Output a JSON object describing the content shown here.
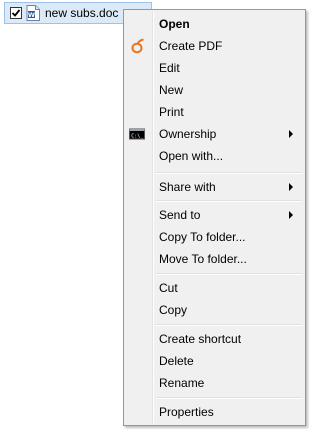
{
  "file": {
    "name": "new subs.doc",
    "checked": true
  },
  "menu": {
    "items": [
      {
        "label": "Open"
      },
      {
        "label": "Create PDF",
        "icon": "pdf-o-icon"
      },
      {
        "label": "Edit"
      },
      {
        "label": "New"
      },
      {
        "label": "Print"
      },
      {
        "label": "Ownership",
        "icon": "console-icon",
        "submenu": true
      },
      {
        "label": "Open with..."
      },
      {
        "label": "Share with",
        "submenu": true
      },
      {
        "label": "Send to",
        "submenu": true
      },
      {
        "label": "Copy To folder..."
      },
      {
        "label": "Move To folder..."
      },
      {
        "label": "Cut"
      },
      {
        "label": "Copy"
      },
      {
        "label": "Create shortcut"
      },
      {
        "label": "Delete"
      },
      {
        "label": "Rename"
      },
      {
        "label": "Properties"
      }
    ]
  },
  "colors": {
    "selection_bg": "#dceaf8",
    "selection_border": "#9dc1e8",
    "menu_bg": "#f0f0f0",
    "menu_border": "#979797",
    "pdf_icon": "#e8731c"
  }
}
